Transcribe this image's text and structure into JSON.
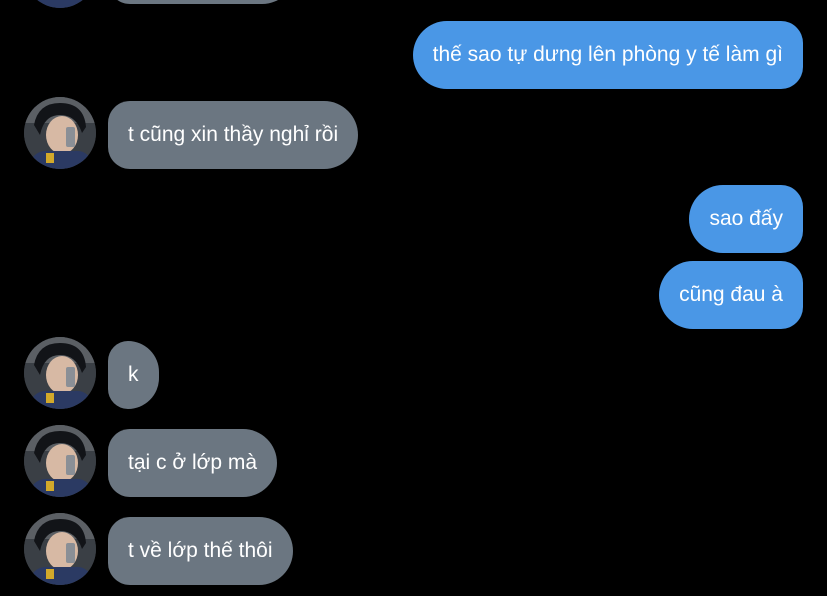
{
  "messages": [
    {
      "side": "in",
      "text": "",
      "avatar": "profile-avatar"
    },
    {
      "side": "out",
      "text": "thế sao tự dưng lên phòng y tế làm gì"
    },
    {
      "side": "in",
      "text": "t cũng xin thầy nghỉ rồi",
      "avatar": "profile-avatar"
    },
    {
      "side": "out",
      "text": "sao đấy"
    },
    {
      "side": "out",
      "text": "cũng đau à"
    },
    {
      "side": "in",
      "text": "k",
      "avatar": "profile-avatar"
    },
    {
      "side": "in",
      "text": "tại c ở lớp mà",
      "avatar": "profile-avatar"
    },
    {
      "side": "in",
      "text": "t về lớp thế thôi",
      "avatar": "profile-avatar"
    }
  ],
  "colors": {
    "background": "#000000",
    "incoming_bubble": "#6b7681",
    "outgoing_bubble": "#4a97e6",
    "text": "#ffffff"
  }
}
